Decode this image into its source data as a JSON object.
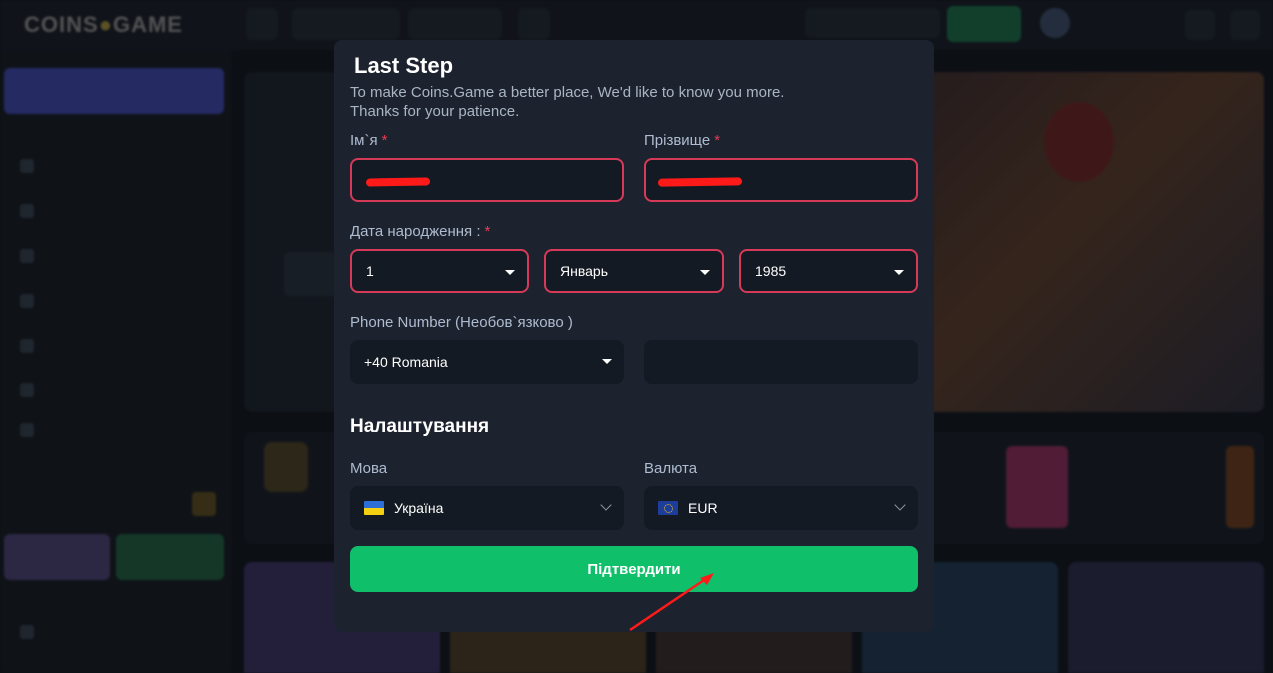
{
  "modal": {
    "title": "Last Step",
    "subtitle_line1": "To make Coins.Game a better place, We'd like to know you more.",
    "subtitle_line2": "Thanks for your patience.",
    "first_name": {
      "label": "Ім`я",
      "required_mark": "*",
      "value": ""
    },
    "last_name": {
      "label": "Прізвище",
      "required_mark": "*",
      "value": ""
    },
    "birth_date": {
      "label": "Дата народження :",
      "required_mark": "*",
      "day": "1",
      "month": "Январь",
      "year": "1985"
    },
    "phone": {
      "label": "Phone Number (Необов`язково )",
      "country": "+40 Romania",
      "number": ""
    },
    "settings": {
      "heading": "Налаштування",
      "language_label": "Мова",
      "language_value": "Україна",
      "currency_label": "Валюта",
      "currency_value": "EUR"
    },
    "confirm_label": "Підтвердити"
  },
  "colors": {
    "modal_bg": "#1c232e",
    "input_bg": "#141a23",
    "error_border": "#d63a58",
    "required": "#e83b55",
    "confirm": "#0fbf6a",
    "annotation": "#ff1a1a"
  },
  "icons": [
    "ukraine-flag-icon",
    "eu-flag-icon",
    "dropdown-caret-icon",
    "chevron-down-icon",
    "annotation-arrow-icon",
    "redaction-scribble"
  ]
}
